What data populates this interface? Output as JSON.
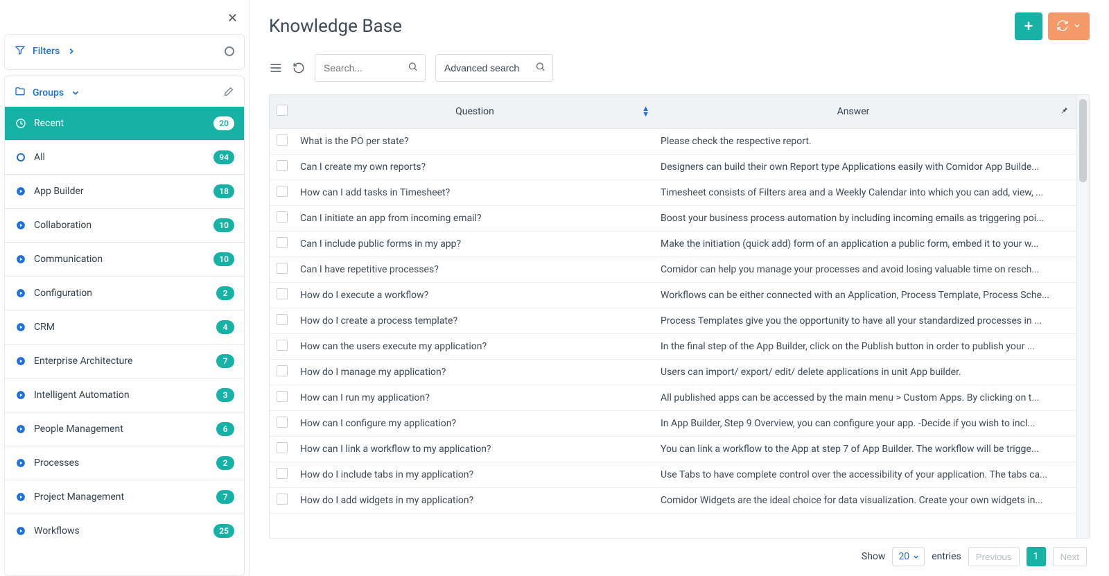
{
  "sidebar": {
    "filters_label": "Filters",
    "groups_label": "Groups",
    "items": [
      {
        "kind": "recent",
        "label": "Recent",
        "count": 20
      },
      {
        "kind": "all",
        "label": "All",
        "count": 94
      },
      {
        "kind": "cat",
        "label": "App Builder",
        "count": 18
      },
      {
        "kind": "cat",
        "label": "Collaboration",
        "count": 10
      },
      {
        "kind": "cat",
        "label": "Communication",
        "count": 10
      },
      {
        "kind": "cat",
        "label": "Configuration",
        "count": 2
      },
      {
        "kind": "cat",
        "label": "CRM",
        "count": 4
      },
      {
        "kind": "cat",
        "label": "Enterprise Architecture",
        "count": 7
      },
      {
        "kind": "cat",
        "label": "Intelligent Automation",
        "count": 3
      },
      {
        "kind": "cat",
        "label": "People Management",
        "count": 6
      },
      {
        "kind": "cat",
        "label": "Processes",
        "count": 2
      },
      {
        "kind": "cat",
        "label": "Project Management",
        "count": 7
      },
      {
        "kind": "cat",
        "label": "Workflows",
        "count": 25
      }
    ]
  },
  "header": {
    "title": "Knowledge Base"
  },
  "toolbar": {
    "search_placeholder": "Search...",
    "advanced_search_label": "Advanced search"
  },
  "columns": {
    "question": "Question",
    "answer": "Answer"
  },
  "rows": [
    {
      "q": "What is the PO per state?",
      "a": "Please check the respective report."
    },
    {
      "q": "Can I create my own reports?",
      "a": "Designers can build their own Report type Applications easily with Comidor App Builde..."
    },
    {
      "q": "How can I add tasks in Timesheet?",
      "a": "Timesheet consists of Filters area and a Weekly Calendar into which you can add, view, ..."
    },
    {
      "q": "Can I initiate an app from incoming email?",
      "a": "Boost your business process automation by including incoming emails as triggering poi..."
    },
    {
      "q": "Can I include public forms in my app?",
      "a": "Make the initiation (quick add) form of an application a public form, embed it to your w..."
    },
    {
      "q": "Can I have repetitive processes?",
      "a": "Comidor can help you manage your processes and avoid losing valuable time on resch..."
    },
    {
      "q": "How do I execute a workflow?",
      "a": "Workflows can be either connected with an Application, Process Template, Process Sche..."
    },
    {
      "q": "How do I create a process template?",
      "a": "Process Templates give you the opportunity to have all your standardized processes in ..."
    },
    {
      "q": "How can the users execute my application?",
      "a": "In the final step of the App Builder, click on the Publish button in order to publish your ..."
    },
    {
      "q": "How do I manage my application?",
      "a": "Users can import/ export/ edit/ delete applications in unit App builder."
    },
    {
      "q": "How can I run my application?",
      "a": "All published apps can be accessed by the main menu > Custom Apps. By clicking on t..."
    },
    {
      "q": "How can I configure my application?",
      "a": "In App Builder, Step 9 Overview, you can configure your app. -Decide if you wish to incl..."
    },
    {
      "q": "How can I link a workflow to my application?",
      "a": "You can link a workflow to the App at step 7 of App Builder. The workflow will be trigge..."
    },
    {
      "q": "How do I include tabs in my application?",
      "a": "Use Tabs to have complete control over the accessibility of your application. The tabs ca..."
    },
    {
      "q": "How do I add widgets in my application?",
      "a": "Comidor Widgets are the ideal choice for data visualization. Create your own widgets in..."
    }
  ],
  "pagination": {
    "show_label": "Show",
    "page_size": "20",
    "entries_label": "entries",
    "previous_label": "Previous",
    "current_page": "1",
    "next_label": "Next"
  }
}
